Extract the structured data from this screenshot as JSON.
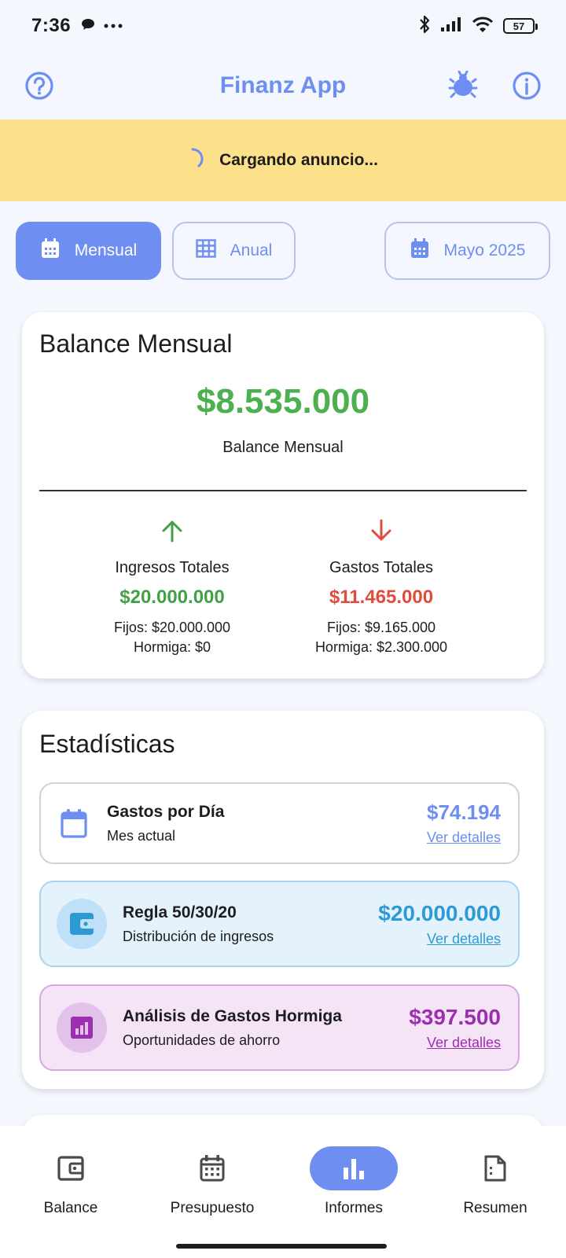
{
  "status_bar": {
    "time": "7:36",
    "battery": "57",
    "icons": [
      "chat-bubble-icon",
      "more-dots-icon",
      "bluetooth-icon",
      "signal-icon",
      "wifi-icon",
      "battery-icon"
    ]
  },
  "app_bar": {
    "title": "Finanz App",
    "left_icon": "help-icon",
    "right_icons": [
      "bug-icon",
      "info-icon"
    ]
  },
  "ad": {
    "text": "Cargando anuncio..."
  },
  "period": {
    "monthly_label": "Mensual",
    "yearly_label": "Anual",
    "month_label": "Mayo 2025",
    "selected": "Mensual"
  },
  "balance_card": {
    "title": "Balance Mensual",
    "amount": "$8.535.000",
    "caption": "Balance Mensual",
    "income": {
      "label": "Ingresos Totales",
      "amount": "$20.000.000",
      "fixed": "Fijos: $20.000.000",
      "ant": "Hormiga: $0"
    },
    "expense": {
      "label": "Gastos Totales",
      "amount": "$11.465.000",
      "fixed": "Fijos: $9.165.000",
      "ant": "Hormiga: $2.300.000"
    }
  },
  "stats_card": {
    "title": "Estadísticas",
    "items": [
      {
        "name": "Gastos por Día",
        "sub": "Mes actual",
        "value": "$74.194",
        "link": "Ver detalles"
      },
      {
        "name": "Regla 50/30/20",
        "sub": "Distribución de ingresos",
        "value": "$20.000.000",
        "link": "Ver detalles"
      },
      {
        "name": "Análisis de Gastos Hormiga",
        "sub": "Oportunidades de ahorro",
        "value": "$397.500",
        "link": "Ver detalles"
      }
    ]
  },
  "bottom_nav": {
    "items": [
      {
        "label": "Balance",
        "icon": "wallet-icon"
      },
      {
        "label": "Presupuesto",
        "icon": "calendar-icon"
      },
      {
        "label": "Informes",
        "icon": "bar-chart-icon"
      },
      {
        "label": "Resumen",
        "icon": "document-icon"
      }
    ],
    "active": "Informes"
  },
  "colors": {
    "primary": "#6e8ef2",
    "ad_background": "#fde18a",
    "income_green": "#43a047",
    "expense_red": "#e14b3c",
    "rule_blue": "#2d9ad6",
    "ant_purple": "#9c2fb0"
  }
}
